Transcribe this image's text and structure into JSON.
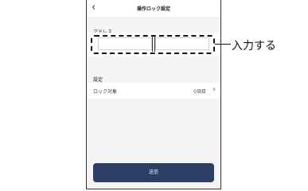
{
  "header": {
    "title": "操作ロック設定",
    "back_icon": "chevron-left-icon"
  },
  "address": {
    "label": "アドレス",
    "input_a_value": "",
    "input_b_value": ""
  },
  "settings": {
    "label": "設定",
    "lock_target_label": "ロック対象",
    "lock_target_value": "0項目",
    "chevron_icon": "chevron-right-icon"
  },
  "footer": {
    "send_label": "送信"
  },
  "annotation": {
    "text": "入力する"
  }
}
